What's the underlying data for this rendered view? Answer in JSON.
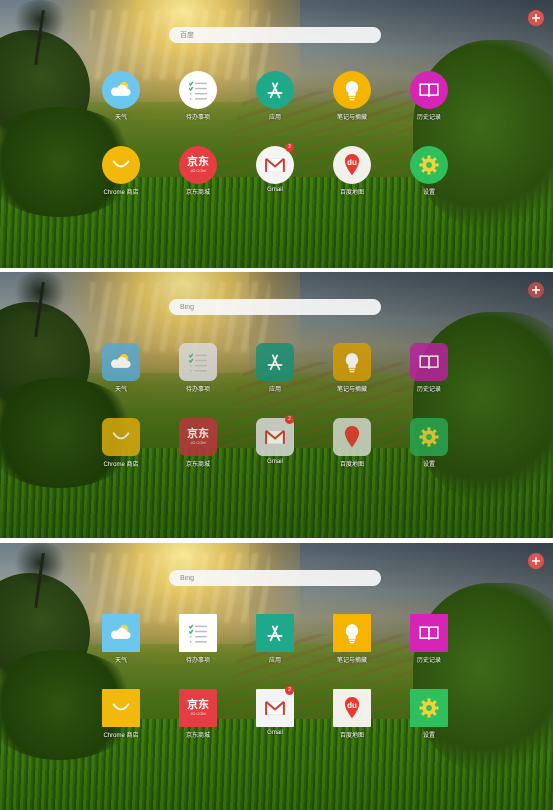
{
  "panels": [
    {
      "style": "round",
      "search": {
        "placeholder": "百度"
      },
      "tiles": [
        {
          "label": "天气",
          "icon": "weather-icon",
          "color": "#6cc7ee"
        },
        {
          "label": "待办事项",
          "icon": "todo-list-icon",
          "color": "#ffffff"
        },
        {
          "label": "应用",
          "icon": "app-store-icon",
          "color": "#1fa98a"
        },
        {
          "label": "笔记与摘藏",
          "icon": "lightbulb-icon",
          "color": "#f4b400"
        },
        {
          "label": "历史记录",
          "icon": "book-icon",
          "color": "#d625b6"
        },
        {
          "label": "Chrome 商店",
          "icon": "smile-bag-icon",
          "color": "#f2b90c"
        },
        {
          "label": "京东商城",
          "icon": "jd-logo-icon",
          "color": "#e53e42",
          "logo_text": "京东",
          "logo_sub": "JD.COM"
        },
        {
          "label": "Gmail",
          "icon": "gmail-icon",
          "color": "#f4f4f4",
          "badge": "2"
        },
        {
          "label": "百度地图",
          "icon": "baidu-map-pin-icon",
          "color": "#f2f0ea",
          "pin_text": "du"
        },
        {
          "label": "设置",
          "icon": "gear-icon",
          "color": "#2fbf5d"
        }
      ]
    },
    {
      "style": "rounded",
      "search": {
        "placeholder": "Bing"
      },
      "tiles": [
        {
          "label": "天气",
          "icon": "weather-icon",
          "color": "#5aa8cf"
        },
        {
          "label": "待办事项",
          "icon": "todo-list-icon",
          "color": "#d8d8d8"
        },
        {
          "label": "应用",
          "icon": "app-store-icon",
          "color": "#1a8f76"
        },
        {
          "label": "笔记与摘藏",
          "icon": "lightbulb-icon",
          "color": "#d39b07"
        },
        {
          "label": "历史记录",
          "icon": "book-icon",
          "color": "#b7239d"
        },
        {
          "label": "Chrome 商店",
          "icon": "smile-bag-icon",
          "color": "#d8a90e"
        },
        {
          "label": "京东商城",
          "icon": "jd-logo-icon",
          "color": "#b8383d",
          "logo_text": "京东",
          "logo_sub": "JD.COM"
        },
        {
          "label": "Gmail",
          "icon": "gmail-icon",
          "color": "#d8d8d8",
          "badge": "2"
        },
        {
          "label": "百度地图",
          "icon": "baidu-map-pin-icon",
          "color": "#cfd6c8",
          "pin_text": ""
        },
        {
          "label": "设置",
          "icon": "gear-icon",
          "color": "#29a551"
        }
      ]
    },
    {
      "style": "flat",
      "search": {
        "placeholder": "Bing"
      },
      "tiles": [
        {
          "label": "天气",
          "icon": "weather-icon",
          "color": "#6cc7ee"
        },
        {
          "label": "待办事项",
          "icon": "todo-list-icon",
          "color": "#ffffff"
        },
        {
          "label": "应用",
          "icon": "app-store-icon",
          "color": "#1fa98a"
        },
        {
          "label": "笔记与摘藏",
          "icon": "lightbulb-icon",
          "color": "#f4b400"
        },
        {
          "label": "历史记录",
          "icon": "book-icon",
          "color": "#d625b6"
        },
        {
          "label": "Chrome 商店",
          "icon": "smile-bag-icon",
          "color": "#f2b90c"
        },
        {
          "label": "京东商城",
          "icon": "jd-logo-icon",
          "color": "#e53e42",
          "logo_text": "京东",
          "logo_sub": "JD.COM"
        },
        {
          "label": "Gmail",
          "icon": "gmail-icon",
          "color": "#f4f4f4",
          "badge": "2"
        },
        {
          "label": "百度地图",
          "icon": "baidu-map-pin-icon",
          "color": "#f2f0ea",
          "pin_text": "du"
        },
        {
          "label": "设置",
          "icon": "gear-icon",
          "color": "#2fbf5d"
        }
      ]
    }
  ],
  "add_button": {
    "icon": "plus-icon",
    "color": "#d9534f"
  }
}
